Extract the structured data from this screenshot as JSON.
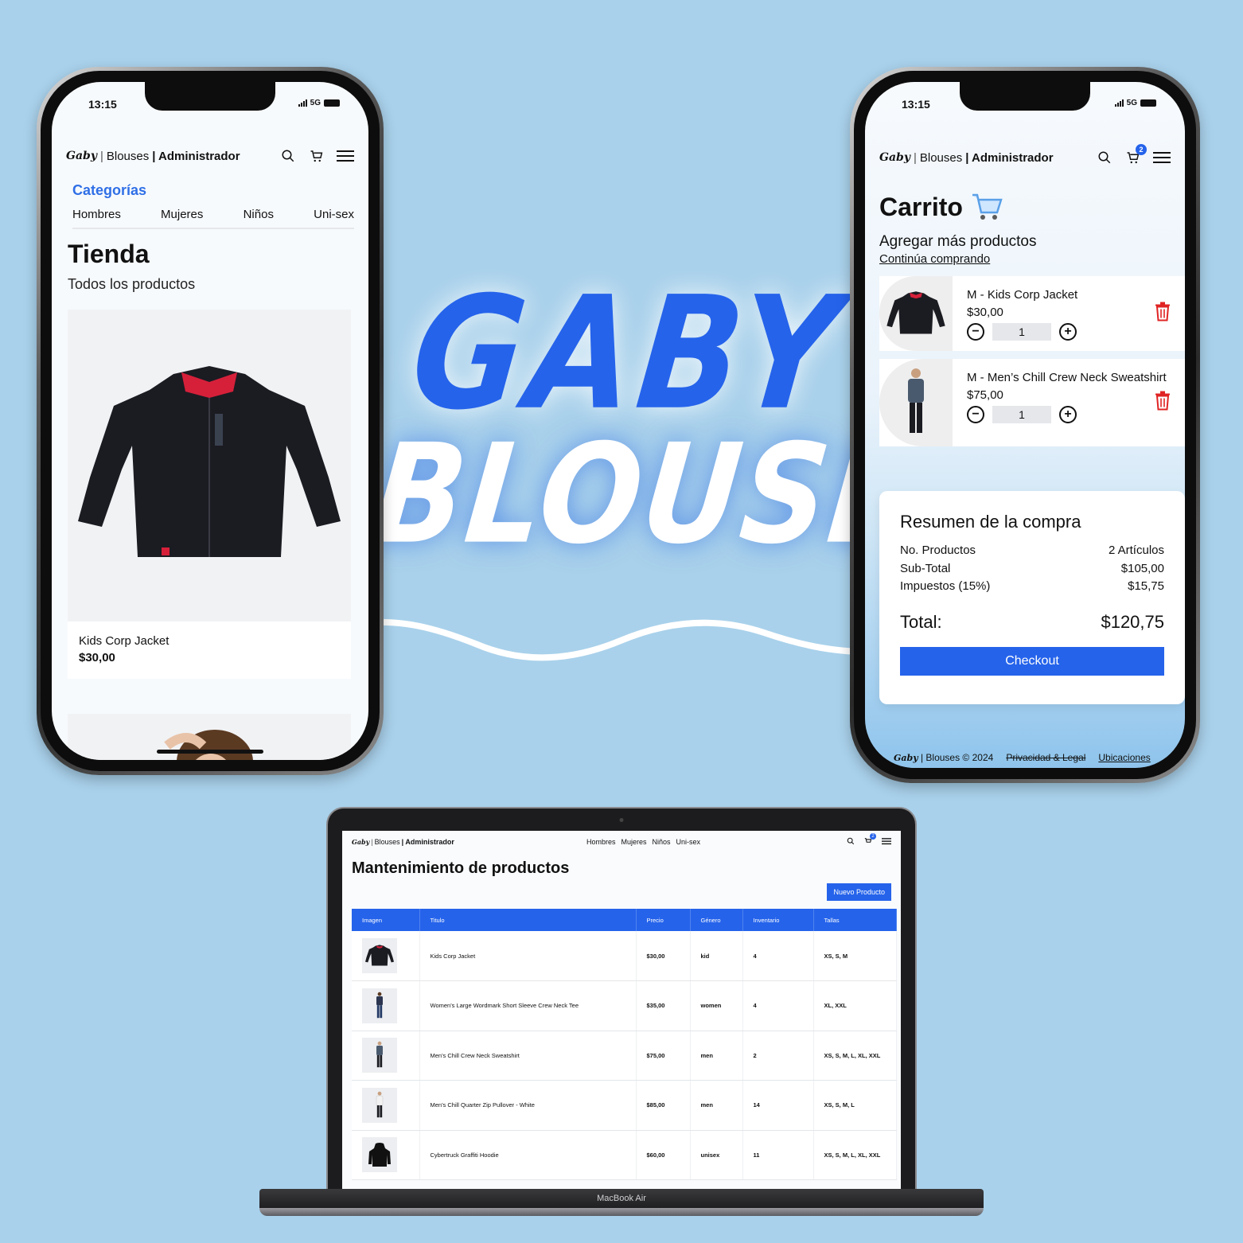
{
  "colors": {
    "background": "#a9d1eb",
    "accent": "#2563eb",
    "danger": "#e02424"
  },
  "hero": {
    "line1": "GABY",
    "line2": "BLOUSES"
  },
  "nav": {
    "logo": "Gaby",
    "separator": "|",
    "brand": "Blouses",
    "admin": "| Administrador",
    "cart_count": "2",
    "icons": [
      "search-icon",
      "cart-icon",
      "menu-icon"
    ]
  },
  "status": {
    "time": "13:15",
    "network": "5G"
  },
  "shop": {
    "categories_title": "Categorías",
    "categories": [
      "Hombres",
      "Mujeres",
      "Niños",
      "Uni-sex"
    ],
    "title": "Tienda",
    "subtitle": "Todos los productos",
    "product": {
      "title": "Kids Corp Jacket",
      "price": "$30,00"
    }
  },
  "cart": {
    "title": "Carrito",
    "add_more": "Agregar más productos",
    "continue": "Continúa comprando",
    "items": [
      {
        "title": "M - Kids Corp Jacket",
        "price": "$30,00",
        "qty": "1"
      },
      {
        "title": "M - Men’s Chill Crew Neck Sweatshirt",
        "price": "$75,00",
        "qty": "1"
      }
    ],
    "summary": {
      "title": "Resumen de la compra",
      "rows": [
        {
          "label": "No. Productos",
          "value": "2 Artículos"
        },
        {
          "label": "Sub-Total",
          "value": "$105,00"
        },
        {
          "label": "Impuestos (15%)",
          "value": "$15,75"
        }
      ],
      "total_label": "Total:",
      "total_value": "$120,75",
      "checkout": "Checkout"
    },
    "footer": {
      "logo": "Gaby",
      "brand": "| Blouses © 2024",
      "privacy": "Privacidad & Legal",
      "locations": "Ubicaciones"
    }
  },
  "admin": {
    "links": [
      "Hombres",
      "Mujeres",
      "Niños",
      "Uni-sex"
    ],
    "title": "Mantenimiento de productos",
    "new_button": "Nuevo Producto",
    "columns": [
      "Imagen",
      "Titulo",
      "Precio",
      "Género",
      "Inventario",
      "Tallas"
    ],
    "rows": [
      {
        "title": "Kids Corp Jacket",
        "price": "$30,00",
        "gender": "kid",
        "stock": "4",
        "sizes": "XS, S, M"
      },
      {
        "title": "Women's Large Wordmark Short Sleeve Crew Neck Tee",
        "price": "$35,00",
        "gender": "women",
        "stock": "4",
        "sizes": "XL, XXL"
      },
      {
        "title": "Men's Chill Crew Neck Sweatshirt",
        "price": "$75,00",
        "gender": "men",
        "stock": "2",
        "sizes": "XS, S, M, L, XL, XXL"
      },
      {
        "title": "Men's Chill Quarter Zip Pullover - White",
        "price": "$85,00",
        "gender": "men",
        "stock": "14",
        "sizes": "XS, S, M, L"
      },
      {
        "title": "Cybertruck Graffiti Hoodie",
        "price": "$60,00",
        "gender": "unisex",
        "stock": "11",
        "sizes": "XS, S, M, L, XL, XXL"
      }
    ]
  },
  "laptop": {
    "label": "MacBook Air"
  }
}
